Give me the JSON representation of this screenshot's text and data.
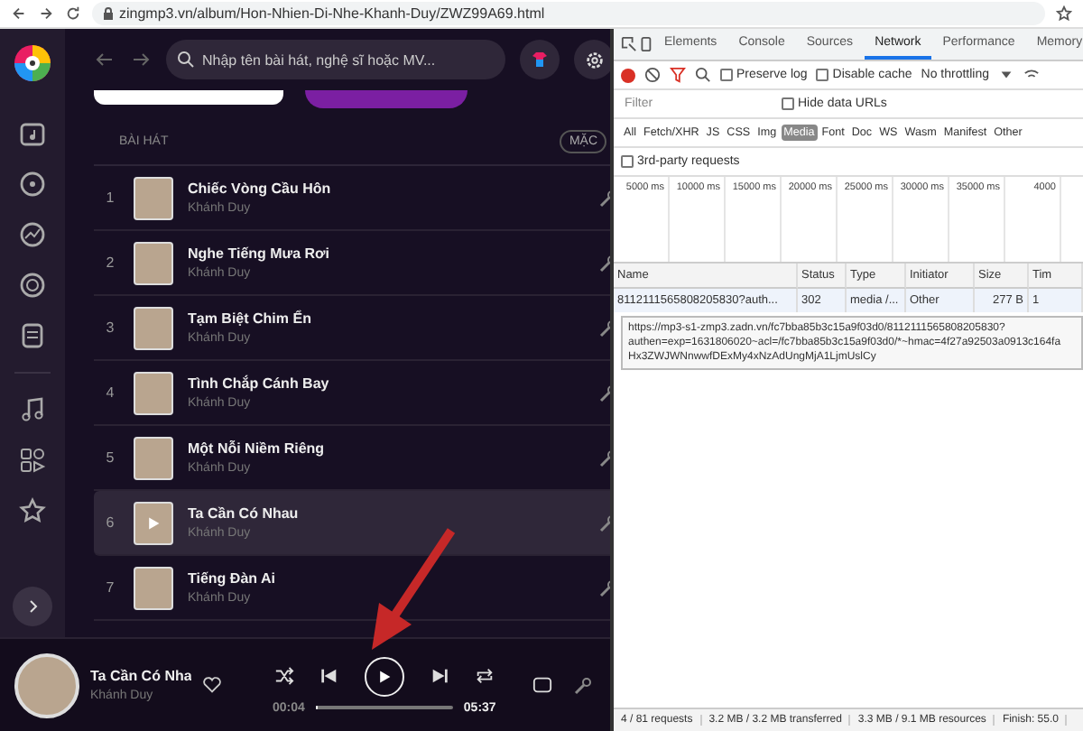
{
  "browser": {
    "url": "zingmp3.vn/album/Hon-Nhien-Di-Nhe-Khanh-Duy/ZWZ99A69.html"
  },
  "header": {
    "search": {
      "placeholder": "Nhập tên bài hát, nghệ sĩ hoặc MV..."
    }
  },
  "songs": {
    "heading": "BÀI HÁT",
    "sort_button": "MẶC",
    "rows": [
      {
        "number": "1",
        "title": "Chiếc Vòng Cầu Hôn",
        "artist": "Khánh Duy",
        "selected": false
      },
      {
        "number": "2",
        "title": "Nghe Tiếng Mưa Rơi",
        "artist": "Khánh Duy",
        "selected": false
      },
      {
        "number": "3",
        "title": "Tạm Biệt Chim Ển",
        "artist": "Khánh Duy",
        "selected": false
      },
      {
        "number": "4",
        "title": "Tình Chắp Cánh Bay",
        "artist": "Khánh Duy",
        "selected": false
      },
      {
        "number": "5",
        "title": "Một Nỗi Niềm Riêng",
        "artist": "Khánh Duy",
        "selected": false
      },
      {
        "number": "6",
        "title": "Ta Cần Có Nhau",
        "artist": "Khánh Duy",
        "selected": true
      },
      {
        "number": "7",
        "title": "Tiếng Đàn Ai",
        "artist": "Khánh Duy",
        "selected": false
      }
    ]
  },
  "player": {
    "title": "Ta Cần Có Nha",
    "artist": "Khánh Duy",
    "elapsed": "00:04",
    "total": "05:37",
    "level": 0.02,
    "playing": false
  },
  "devtools": {
    "tabs": [
      {
        "label": "Elements",
        "selected": false
      },
      {
        "label": "Console",
        "selected": false
      },
      {
        "label": "Sources",
        "selected": false
      },
      {
        "label": "Network",
        "selected": true
      },
      {
        "label": "Performance",
        "selected": false
      },
      {
        "label": "Memory",
        "selected": false
      }
    ],
    "toolbar": {
      "checkboxes": [
        {
          "label": "Preserve log",
          "checked": false
        },
        {
          "label": "Disable cache",
          "checked": false
        }
      ],
      "throttling": "No throttling",
      "recording": true
    },
    "filter": {
      "placeholder": "Filter",
      "hide_data_urls": {
        "label": "Hide data URLs",
        "checked": false
      }
    },
    "type_filters": [
      {
        "label": "All",
        "selected": false
      },
      {
        "label": "Fetch/XHR",
        "selected": false
      },
      {
        "label": "JS",
        "selected": false
      },
      {
        "label": "CSS",
        "selected": false
      },
      {
        "label": "Img",
        "selected": false
      },
      {
        "label": "Media",
        "selected": true
      },
      {
        "label": "Font",
        "selected": false
      },
      {
        "label": "Doc",
        "selected": false
      },
      {
        "label": "WS",
        "selected": false
      },
      {
        "label": "Wasm",
        "selected": false
      },
      {
        "label": "Manifest",
        "selected": false
      },
      {
        "label": "Other",
        "selected": false
      }
    ],
    "third_party": {
      "label": "3rd-party requests",
      "checked": false
    },
    "timeline_ticks": [
      "5000 ms",
      "10000 ms",
      "15000 ms",
      "20000 ms",
      "25000 ms",
      "30000 ms",
      "35000 ms",
      "4000"
    ],
    "table": {
      "columns": [
        "Name",
        "Status",
        "Type",
        "Initiator",
        "Size",
        "Tim"
      ],
      "rows": [
        {
          "cells": [
            "8112111565808205830?auth...",
            "302",
            "media /...",
            "Other",
            "277 B",
            "1"
          ]
        }
      ]
    },
    "tooltip": [
      "https://mp3-s1-zmp3.zadn.vn/fc7bba85b3c15a9f03d0/8112111565808205830?",
      "authen=exp=1631806020~acl=/fc7bba85b3c15a9f03d0/*~hmac=4f27a92503a0913c164fa",
      "Hx3ZWJWNnwwfDExMy4xNzAdUngMjA1LjmUslCy"
    ],
    "status_bar": [
      "4 / 81 requests",
      "3.2 MB / 3.2 MB transferred",
      "3.3 MB / 9.1 MB resources",
      "Finish: 55.0"
    ]
  }
}
